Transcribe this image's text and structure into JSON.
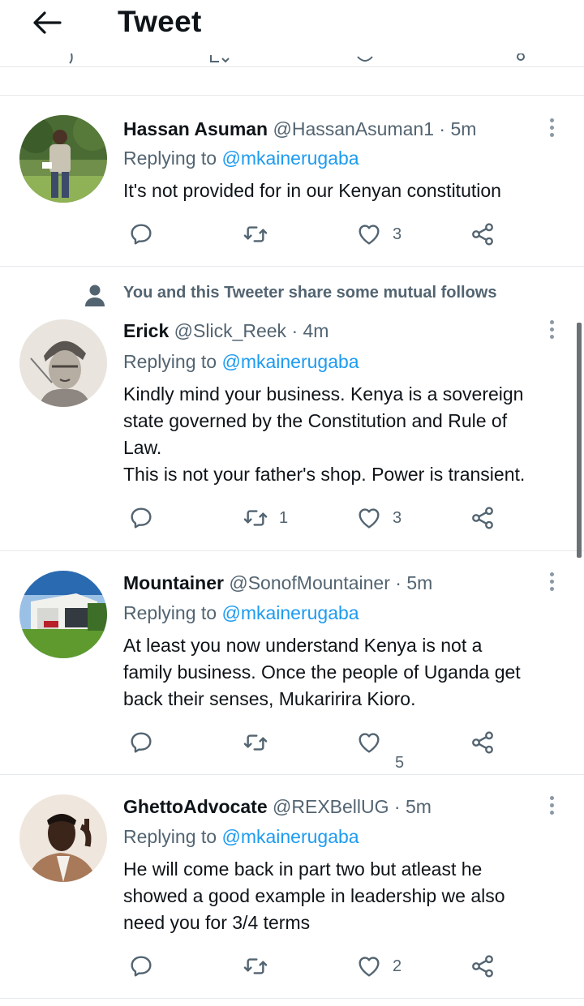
{
  "header": {
    "title": "Tweet",
    "back_icon": "arrow-left-icon"
  },
  "colors": {
    "link": "#1d9bf0",
    "muted": "#536471",
    "text": "#0f1419",
    "separator": "#e6e9eb"
  },
  "tweets": [
    {
      "name": "Hassan Asuman",
      "handle": "@HassanAsuman1",
      "time": "· 5m",
      "replying_prefix": "Replying to",
      "replying_to": "@mkainerugaba",
      "lines": [
        "It's not provided for in our Kenyan constitution"
      ],
      "replies": "",
      "retweets": "",
      "likes": "3"
    },
    {
      "mutual_note": "You and this Tweeter share some mutual follows",
      "name": "Erick",
      "handle": "@Slick_Reek",
      "time": "· 4m",
      "replying_prefix": "Replying to",
      "replying_to": "@mkainerugaba",
      "lines": [
        "Kindly mind your business. Kenya is a sovereign",
        "state governed by the Constitution and Rule of",
        "Law.",
        "This is not your father's shop. Power is transient."
      ],
      "replies": "",
      "retweets": "1",
      "likes": "3"
    },
    {
      "name": "Mountainer",
      "handle": "@SonofMountainer",
      "time": "· 5m",
      "replying_prefix": "Replying to",
      "replying_to": "@mkainerugaba",
      "lines": [
        "At least you now understand Kenya is not a",
        "family business. Once the people of Uganda get",
        "back their senses, Mukaririra Kioro."
      ],
      "replies": "",
      "retweets": "",
      "likes": "5"
    },
    {
      "name": "GhettoAdvocate",
      "handle": "@REXBellUG",
      "time": "· 5m",
      "replying_prefix": "Replying to",
      "replying_to": "@mkainerugaba",
      "lines": [
        "He will come back in part two but atleast he",
        "showed a good example in leadership we also",
        "need you for 3/4 terms"
      ],
      "replies": "",
      "retweets": "",
      "likes": "2"
    }
  ]
}
